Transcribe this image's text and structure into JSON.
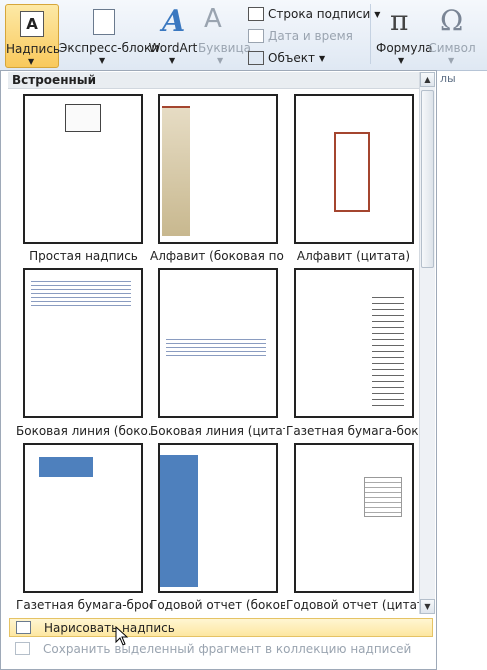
{
  "ribbon": {
    "nadpis": "Надпись",
    "express": "Экспресс-блоки",
    "wordart": "WordArt",
    "bukvitsa": "Буквица",
    "signature": "Строка подписи",
    "datetime": "Дата и время",
    "object": "Объект",
    "formula": "Формула",
    "symbol": "Символ",
    "group_partial": "лы"
  },
  "panel": {
    "section": "Встроенный",
    "items": [
      {
        "caption": "Простая надпись"
      },
      {
        "caption": "Алфавит (боковая по..."
      },
      {
        "caption": "Алфавит (цитата)"
      },
      {
        "caption": "Боковая линия (боко..."
      },
      {
        "caption": "Боковая линия (цитата)"
      },
      {
        "caption": "Газетная бумага-боко..."
      },
      {
        "caption": "Газетная бумага-брос..."
      },
      {
        "caption": "Годовой отчет (боков..."
      },
      {
        "caption": "Годовой отчет (цитата)"
      }
    ],
    "menu": {
      "draw": "Нарисовать надпись",
      "save": "Сохранить выделенный фрагмент в коллекцию надписей"
    }
  },
  "colors": {
    "accent": "#f9c95c",
    "panel_border": "#9ea9b8"
  }
}
